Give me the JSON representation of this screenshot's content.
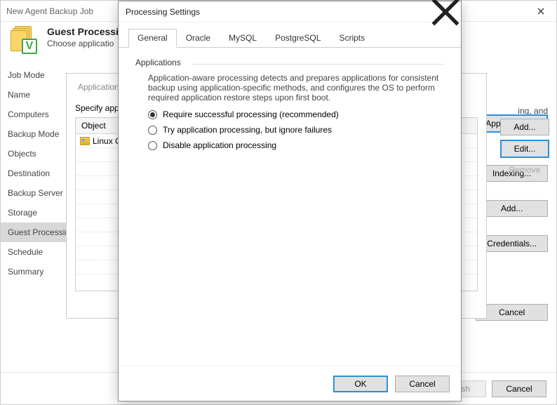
{
  "wizard": {
    "window_title": "New Agent Backup Job",
    "header_title": "Guest Processing",
    "header_sub": "Choose applicatio",
    "steps": [
      "Job Mode",
      "Name",
      "Computers",
      "Backup Mode",
      "Objects",
      "Destination",
      "Backup Server",
      "Storage",
      "Guest Processing",
      "Schedule",
      "Summary"
    ],
    "active_step_index": 8,
    "right_frag_text": "ing, and",
    "side_buttons": {
      "applications": "Applications...",
      "indexing": "Indexing...",
      "add": "Add...",
      "credentials": "Credentials...",
      "cancel": "Cancel"
    },
    "footer": {
      "finish": "Finish",
      "cancel": "Cancel"
    }
  },
  "mid": {
    "title": "Application-",
    "specify": "Specify app",
    "col_object": "Object",
    "row1": "Linux C",
    "buttons": {
      "add": "Add...",
      "edit": "Edit...",
      "remove": "Remove"
    }
  },
  "dialog": {
    "title": "Processing Settings",
    "tabs": [
      "General",
      "Oracle",
      "MySQL",
      "PostgreSQL",
      "Scripts"
    ],
    "active_tab_index": 0,
    "group_label": "Applications",
    "description": "Application-aware processing detects and prepares applications for consistent backup using application-specific methods, and configures the OS to perform required application restore steps upon first boot.",
    "options": [
      "Require successful processing (recommended)",
      "Try application processing, but ignore failures",
      "Disable application processing"
    ],
    "selected_option_index": 0,
    "ok": "OK",
    "cancel": "Cancel"
  }
}
